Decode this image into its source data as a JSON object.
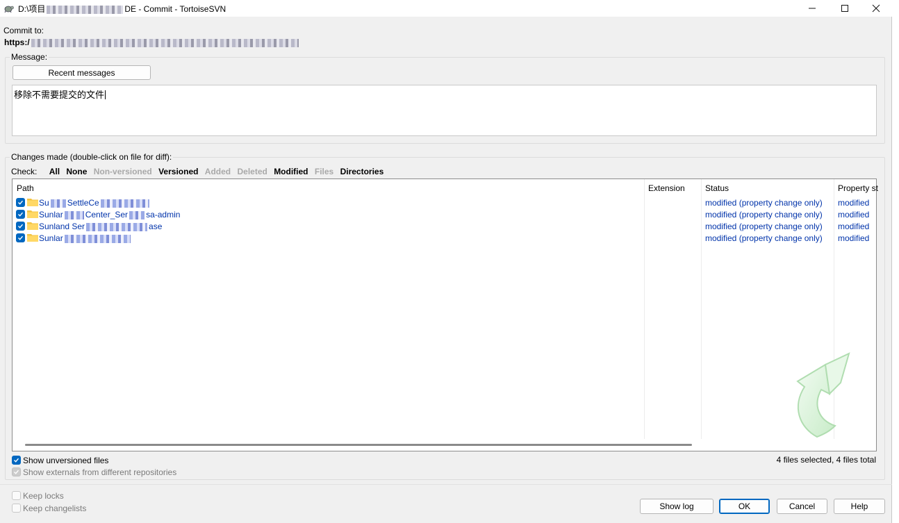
{
  "titlebar": {
    "title_prefix": "D:\\项目",
    "title_suffix": "DE - Commit - TortoiseSVN",
    "minimize_label": "─",
    "maximize_label": "☐",
    "close_label": "✕"
  },
  "commit": {
    "label": "Commit to:",
    "url_prefix": "https:/"
  },
  "message": {
    "group_label": "Message:",
    "recent_button": "Recent messages",
    "text": "移除不需要提交的文件"
  },
  "changes": {
    "group_label": "Changes made (double-click on file for diff):",
    "check_label": "Check:",
    "filters": [
      {
        "label": "All",
        "enabled": true
      },
      {
        "label": "None",
        "enabled": true
      },
      {
        "label": "Non-versioned",
        "enabled": false
      },
      {
        "label": "Versioned",
        "enabled": true
      },
      {
        "label": "Added",
        "enabled": false
      },
      {
        "label": "Deleted",
        "enabled": false
      },
      {
        "label": "Modified",
        "enabled": true
      },
      {
        "label": "Files",
        "enabled": false
      },
      {
        "label": "Directories",
        "enabled": true
      }
    ],
    "columns": {
      "path": "Path",
      "extension": "Extension",
      "status": "Status",
      "property_status": "Property st"
    },
    "rows": [
      {
        "path_a": "Su",
        "path_b": "SettleCe",
        "status": "modified (property change only)",
        "property_status": "modified"
      },
      {
        "path_a": "Sunlar",
        "path_b": "Center_Ser",
        "path_c": "sa-admin",
        "status": "modified (property change only)",
        "property_status": "modified"
      },
      {
        "path_a": "Sunland Ser",
        "path_c": "ase",
        "status": "modified (property change only)",
        "property_status": "modified"
      },
      {
        "path_a": "Sunlar",
        "status": "modified (property change only)",
        "property_status": "modified"
      }
    ],
    "show_unversioned": "Show unversioned files",
    "show_externals": "Show externals from different repositories",
    "summary": "4 files selected, 4 files total"
  },
  "options": {
    "keep_locks": "Keep locks",
    "keep_changelists": "Keep changelists"
  },
  "buttons": {
    "show_log": "Show log",
    "ok": "OK",
    "cancel": "Cancel",
    "help": "Help"
  },
  "colors": {
    "accent": "#0067c0",
    "link_blue": "#0033aa",
    "disabled_gray": "#a9a9a9"
  }
}
